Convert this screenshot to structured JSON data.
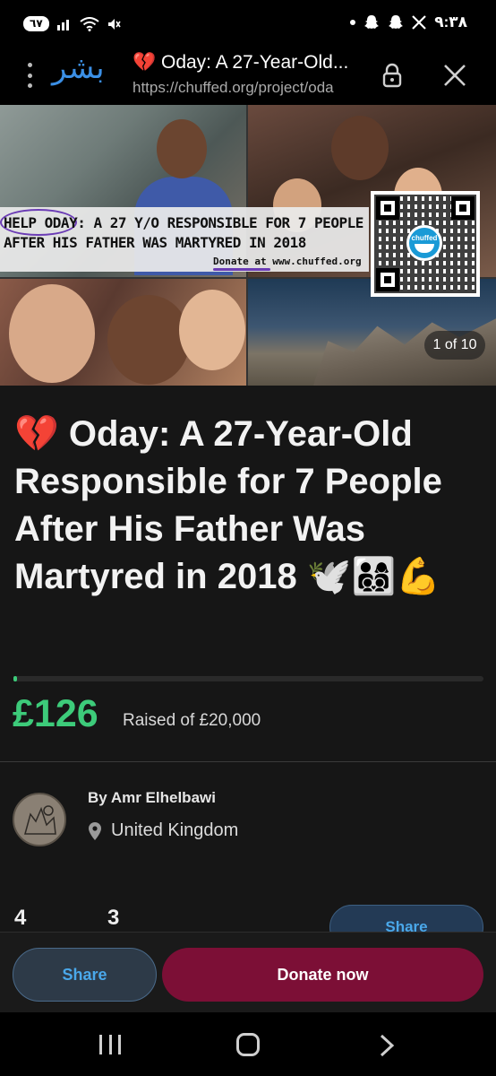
{
  "status_bar": {
    "battery": "٦٧",
    "time": "٩:٣٨",
    "icons": [
      "signal-icon",
      "wifi-icon",
      "mute-icon",
      "snapchat-icon",
      "snapchat-icon",
      "x-icon"
    ]
  },
  "browser": {
    "brand_logo": "بشر",
    "tab_title": "💔 Oday: A 27-Year-Old...",
    "url": "https://chuffed.org/project/oda"
  },
  "hero": {
    "banner_line1": "HELP ODAY: A 27 Y/O RESPONSIBLE FOR 7 PEOPLE",
    "banner_line2": "AFTER HIS FATHER WAS MARTYRED IN 2018",
    "banner_donate": "Donate at www.chuffed.org",
    "qr_label": "chuffed",
    "counter": "1 of 10"
  },
  "campaign": {
    "title": "💔 Oday: A 27-Year-Old Responsible for 7 People After His Father Was Martyred in 2018 🕊️👨‍👩‍👦‍👦💪",
    "progress_fraction": 0.0063,
    "raised": "£126",
    "raised_label": "Raised of £20,000",
    "author": "By Amr Elhelbawi",
    "location": "United Kingdom",
    "stat_1": "4",
    "stat_2": "3",
    "share_inline": "Share"
  },
  "actions": {
    "share": "Share",
    "donate": "Donate now"
  },
  "colors": {
    "accent_green": "#3dcb7a",
    "donate_bg": "#7c0f36",
    "share_text": "#4aa8ea",
    "brand_blue": "#3b8fe5"
  }
}
